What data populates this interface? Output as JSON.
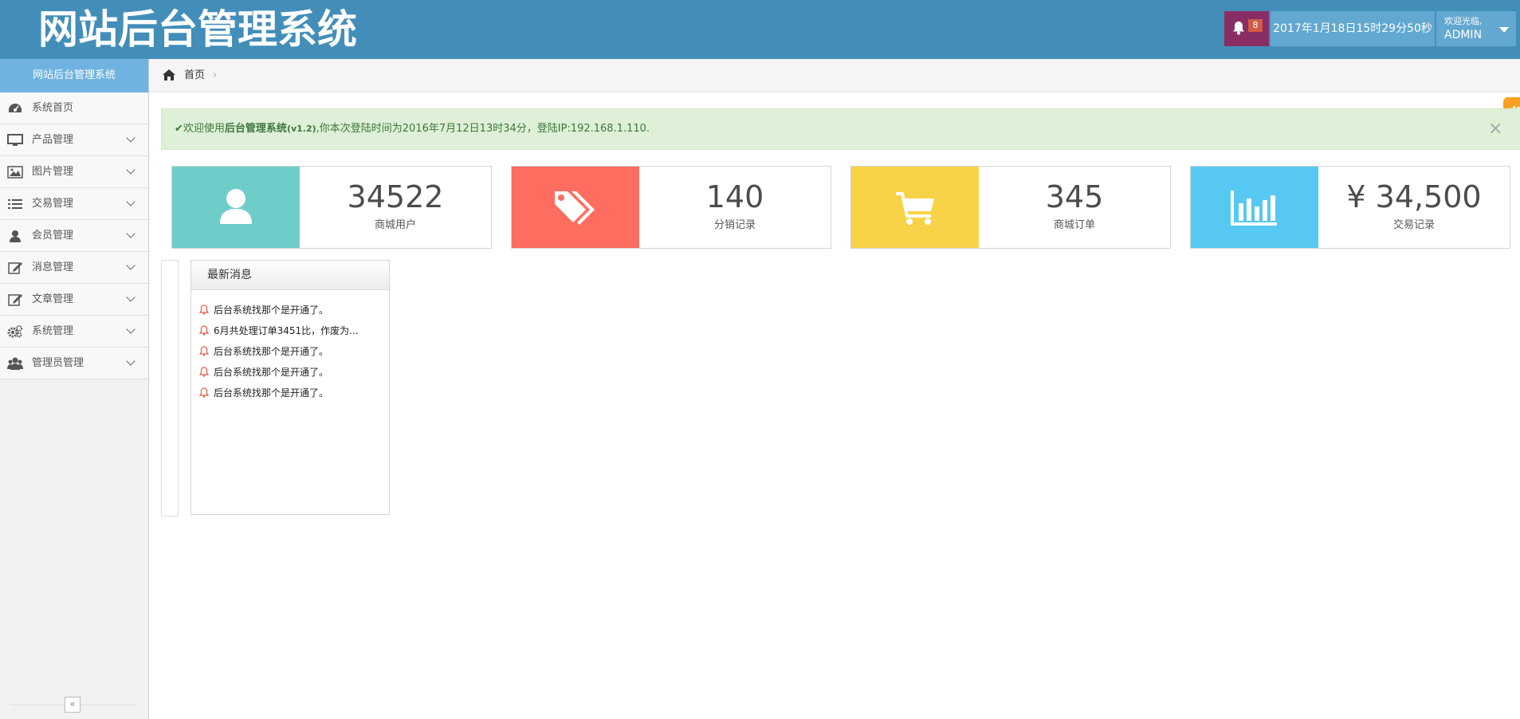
{
  "header": {
    "logo": "网站后台管理系统",
    "notification_count": "8",
    "datetime": "2017年1月18日15时29分50秒",
    "welcome": "欢迎光临,",
    "username": "ADMIN"
  },
  "sidebar": {
    "title": "网站后台管理系统",
    "items": [
      {
        "label": "系统首页",
        "icon": "dashboard-icon"
      },
      {
        "label": "产品管理",
        "icon": "desktop-icon"
      },
      {
        "label": "图片管理",
        "icon": "picture-icon"
      },
      {
        "label": "交易管理",
        "icon": "list-icon"
      },
      {
        "label": "会员管理",
        "icon": "user-icon"
      },
      {
        "label": "消息管理",
        "icon": "edit-icon"
      },
      {
        "label": "文章管理",
        "icon": "edit-icon"
      },
      {
        "label": "系统管理",
        "icon": "cogs-icon"
      },
      {
        "label": "管理员管理",
        "icon": "group-icon"
      }
    ],
    "collapse_glyph": "«"
  },
  "breadcrumb": {
    "home": "首页",
    "separator": "›"
  },
  "alert": {
    "check": "✔",
    "prefix": "欢迎使用",
    "system_name": "后台管理系统",
    "version": "(v1.2)",
    "suffix": ",你本次登陆时间为2016年7月12日13时34分，登陆IP:192.168.1.110.",
    "close": "×"
  },
  "stats": [
    {
      "value": "34522",
      "label": "商城用户",
      "color": "#6fcdc9",
      "icon": "user-icon"
    },
    {
      "value": "140",
      "label": "分销记录",
      "color": "#ff6c60",
      "icon": "tags-icon"
    },
    {
      "value": "345",
      "label": "商城订单",
      "color": "#f8d347",
      "icon": "shopping-cart-icon"
    },
    {
      "value": "¥ 34,500",
      "label": "交易记录",
      "color": "#57c8f2",
      "icon": "bar-chart-icon"
    }
  ],
  "messages": {
    "title": "最新消息",
    "items": [
      "后台系统找那个是开通了。",
      "6月共处理订单3451比，作废为...",
      "后台系统找那个是开通了。",
      "后台系统找那个是开通了。",
      "后台系统找那个是开通了。"
    ]
  },
  "colors": {
    "header": "#438eb9",
    "notification": "#892e65",
    "sidebar_title": "#6fb3e0",
    "alert_bg": "#dff0d8",
    "alert_text": "#3c763d",
    "settings": "#f9a021"
  }
}
